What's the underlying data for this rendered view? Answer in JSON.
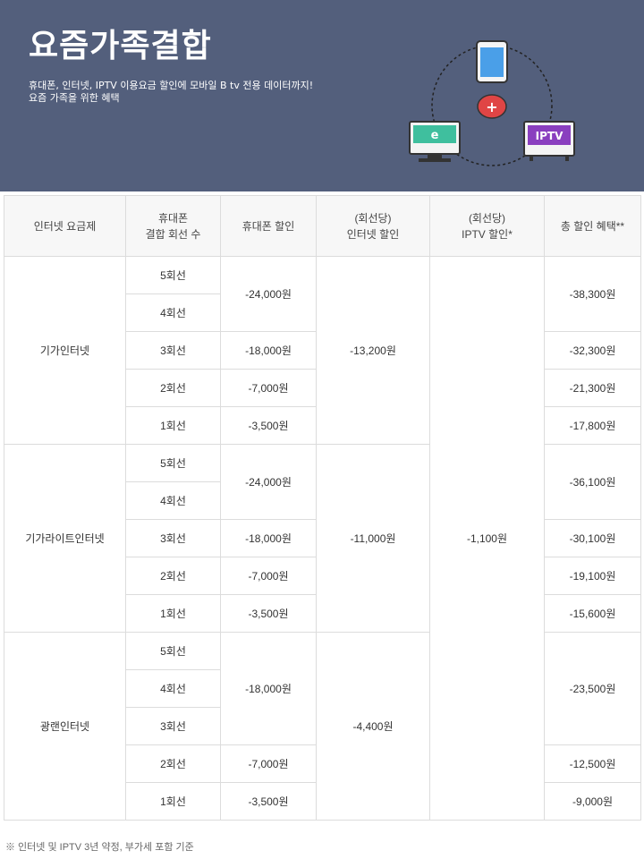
{
  "banner": {
    "title": "요즘가족결합",
    "desc_line1": "휴대폰, 인터넷, IPTV 이용요금 할인에 모바일 B tv 전용 데이터까지!",
    "desc_line2": "요즘 가족을 위한 혜택",
    "icons": {
      "internet": "e",
      "iptv": "IPTV",
      "plus": "+"
    },
    "colors": {
      "background": "#535f7c",
      "phone": "#4a9fe8",
      "pc": "#3fbf9e",
      "tv": "#8a3fbf",
      "plus": "#e04545"
    }
  },
  "table": {
    "headers": {
      "plan": "인터넷 요금제",
      "lines_1": "휴대폰",
      "lines_2": "결합 회선 수",
      "phone": "휴대폰 할인",
      "internet_1": "(회선당)",
      "internet_2": "인터넷 할인",
      "iptv_1": "(회선당)",
      "iptv_2": "IPTV 할인*",
      "total": "총 할인 혜택**"
    },
    "groups": [
      {
        "plan": "기가인터넷",
        "internet": "-13,200원",
        "lines": [
          "5회선",
          "4회선",
          "3회선",
          "2회선",
          "1회선"
        ],
        "phone": [
          "-24,000원",
          "-18,000원",
          "-7,000원",
          "-3,500원"
        ],
        "total": [
          "-38,300원",
          "-32,300원",
          "-21,300원",
          "-17,800원"
        ]
      },
      {
        "plan": "기가라이트인터넷",
        "internet": "-11,000원",
        "lines": [
          "5회선",
          "4회선",
          "3회선",
          "2회선",
          "1회선"
        ],
        "phone": [
          "-24,000원",
          "-18,000원",
          "-7,000원",
          "-3,500원"
        ],
        "total": [
          "-36,100원",
          "-30,100원",
          "-19,100원",
          "-15,600원"
        ]
      },
      {
        "plan": "광랜인터넷",
        "internet": "-4,400원",
        "lines": [
          "5회선",
          "4회선",
          "3회선",
          "2회선",
          "1회선"
        ],
        "phone": [
          "-18,000원",
          "-7,000원",
          "-3,500원"
        ],
        "total": [
          "-23,500원",
          "-12,500원",
          "-9,000원"
        ]
      }
    ],
    "iptv": "-1,100원"
  },
  "note": "※ 인터넷 및 IPTV 3년 약정, 부가세 포함 기준"
}
